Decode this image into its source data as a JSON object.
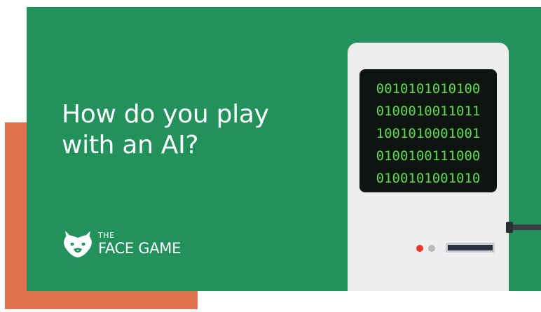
{
  "headline": {
    "line1": "How do you play",
    "line2": "with an AI?"
  },
  "brand": {
    "small": "THE",
    "name": "FACE GAME",
    "icon": "wolf-face-icon"
  },
  "computer": {
    "screen_lines": [
      "0010101010100",
      "0100010011011",
      "1001010001001",
      "0100100111000",
      "0100101001010"
    ],
    "indicators": [
      "red-led",
      "grey-led"
    ],
    "slot": "card-slot"
  },
  "colors": {
    "background_green": "#22915c",
    "accent_orange": "#e0704e",
    "screen_text_green": "#5fd94d",
    "machine_body": "#eeeeec"
  }
}
